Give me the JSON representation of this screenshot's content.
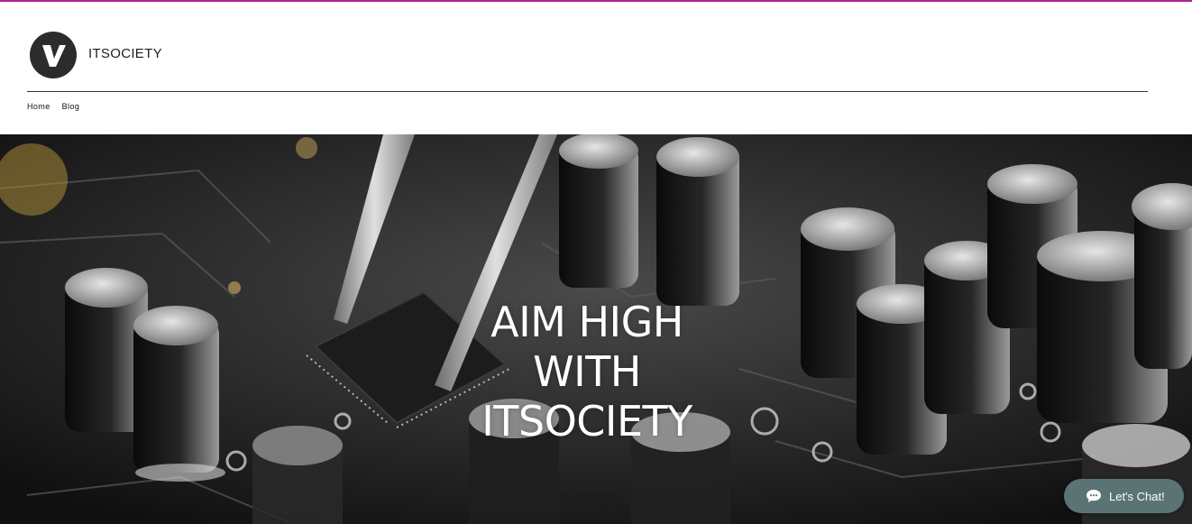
{
  "site": {
    "name": "ITSOCIETY"
  },
  "nav": {
    "items": [
      "Home",
      "Blog"
    ]
  },
  "hero": {
    "headline_lines": [
      "AIM HIGH",
      "WITH",
      "ITSOCIETY"
    ]
  },
  "chat": {
    "label": "Let's Chat!"
  },
  "colors": {
    "accent_line": "#b0268f",
    "chat_bg": "#5a7476",
    "logo_bg": "#2c2c2c"
  },
  "icons": {
    "logo": "v-logo-icon",
    "chat": "chat-bubble-icon"
  }
}
